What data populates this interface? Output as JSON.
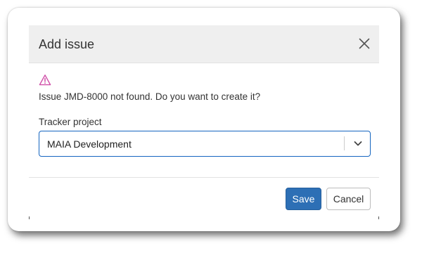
{
  "dialog": {
    "title": "Add issue",
    "close_icon": "close-icon",
    "warning_icon": "warning-triangle-icon",
    "message": "Issue JMD-8000 not found. Do you want to create it?",
    "tracker_label": "Tracker project",
    "tracker_value": "MAIA Development",
    "chevron_icon": "chevron-down-icon"
  },
  "buttons": {
    "save": "Save",
    "cancel": "Cancel"
  },
  "colors": {
    "primary": "#2d6fb5",
    "warning_icon": "#d04fa8",
    "focus_border": "#1565c0",
    "header_bg": "#efefef"
  }
}
